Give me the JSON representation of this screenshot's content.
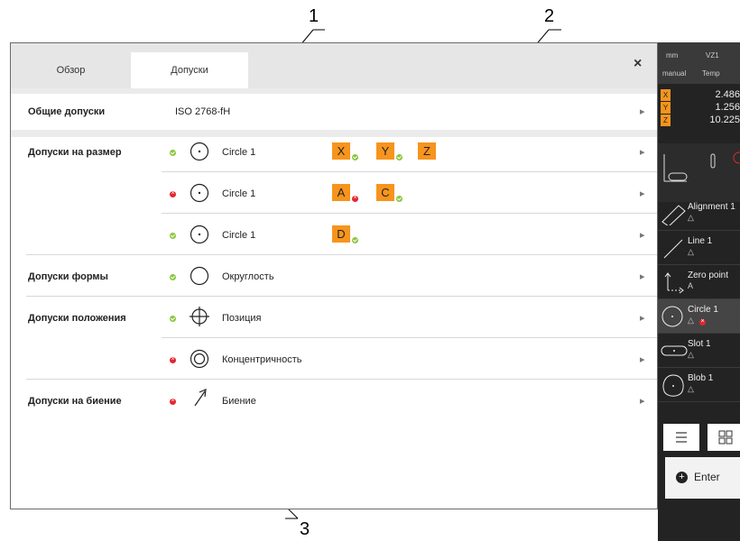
{
  "callouts": [
    "1",
    "2",
    "3"
  ],
  "tabs": [
    {
      "label": "Обзор"
    },
    {
      "label": "Допуски"
    }
  ],
  "close_label": "×",
  "general": {
    "label": "Общие допуски",
    "value": "ISO 2768-fH"
  },
  "groups": {
    "size": "Допуски на размер",
    "form": "Допуски формы",
    "position": "Допуски положения",
    "runout": "Допуски на биение"
  },
  "rows": [
    {
      "status": "ok",
      "icon": "circle-center-icon",
      "name": "Circle 1",
      "badges": [
        {
          "l": "X",
          "s": "ok"
        },
        {
          "l": "Y",
          "s": "ok"
        },
        {
          "l": "Z",
          "s": "none"
        }
      ]
    },
    {
      "status": "error",
      "icon": "circle-center-icon",
      "name": "Circle 1",
      "badges": [
        {
          "l": "A",
          "s": "error"
        },
        {
          "l": "C",
          "s": "ok"
        }
      ]
    },
    {
      "status": "ok",
      "icon": "circle-center-icon",
      "name": "Circle 1",
      "badges": [
        {
          "l": "D",
          "s": "ok"
        }
      ]
    },
    {
      "status": "ok",
      "icon": "circularity-icon",
      "name": "Округлость",
      "badges": []
    },
    {
      "status": "ok",
      "icon": "position-icon",
      "name": "Позиция",
      "badges": []
    },
    {
      "status": "error",
      "icon": "concentricity-icon",
      "name": "Концентричность",
      "badges": []
    },
    {
      "status": "error",
      "icon": "runout-icon",
      "name": "Биение",
      "badges": []
    }
  ],
  "sidebar": {
    "unit": "mm",
    "vz": "VZ1",
    "mode": "manual",
    "temp": "Temp",
    "coords": [
      {
        "axis": "X",
        "value": "2.486"
      },
      {
        "axis": "Y",
        "value": "1.256"
      },
      {
        "axis": "Z",
        "value": "10.225"
      }
    ],
    "features": [
      {
        "name": "Alignment 1",
        "sub": "△",
        "icon": "alignment-icon"
      },
      {
        "name": "Line 1",
        "sub": "△",
        "icon": "line-icon"
      },
      {
        "name": "Zero point",
        "sub": "A",
        "icon": "zero-point-icon"
      },
      {
        "name": "Circle 1",
        "sub": "△",
        "icon": "circle-icon"
      },
      {
        "name": "Slot 1",
        "sub": "△",
        "icon": "slot-icon"
      },
      {
        "name": "Blob 1",
        "sub": "△",
        "icon": "blob-icon"
      }
    ],
    "enter_label": "Enter"
  }
}
